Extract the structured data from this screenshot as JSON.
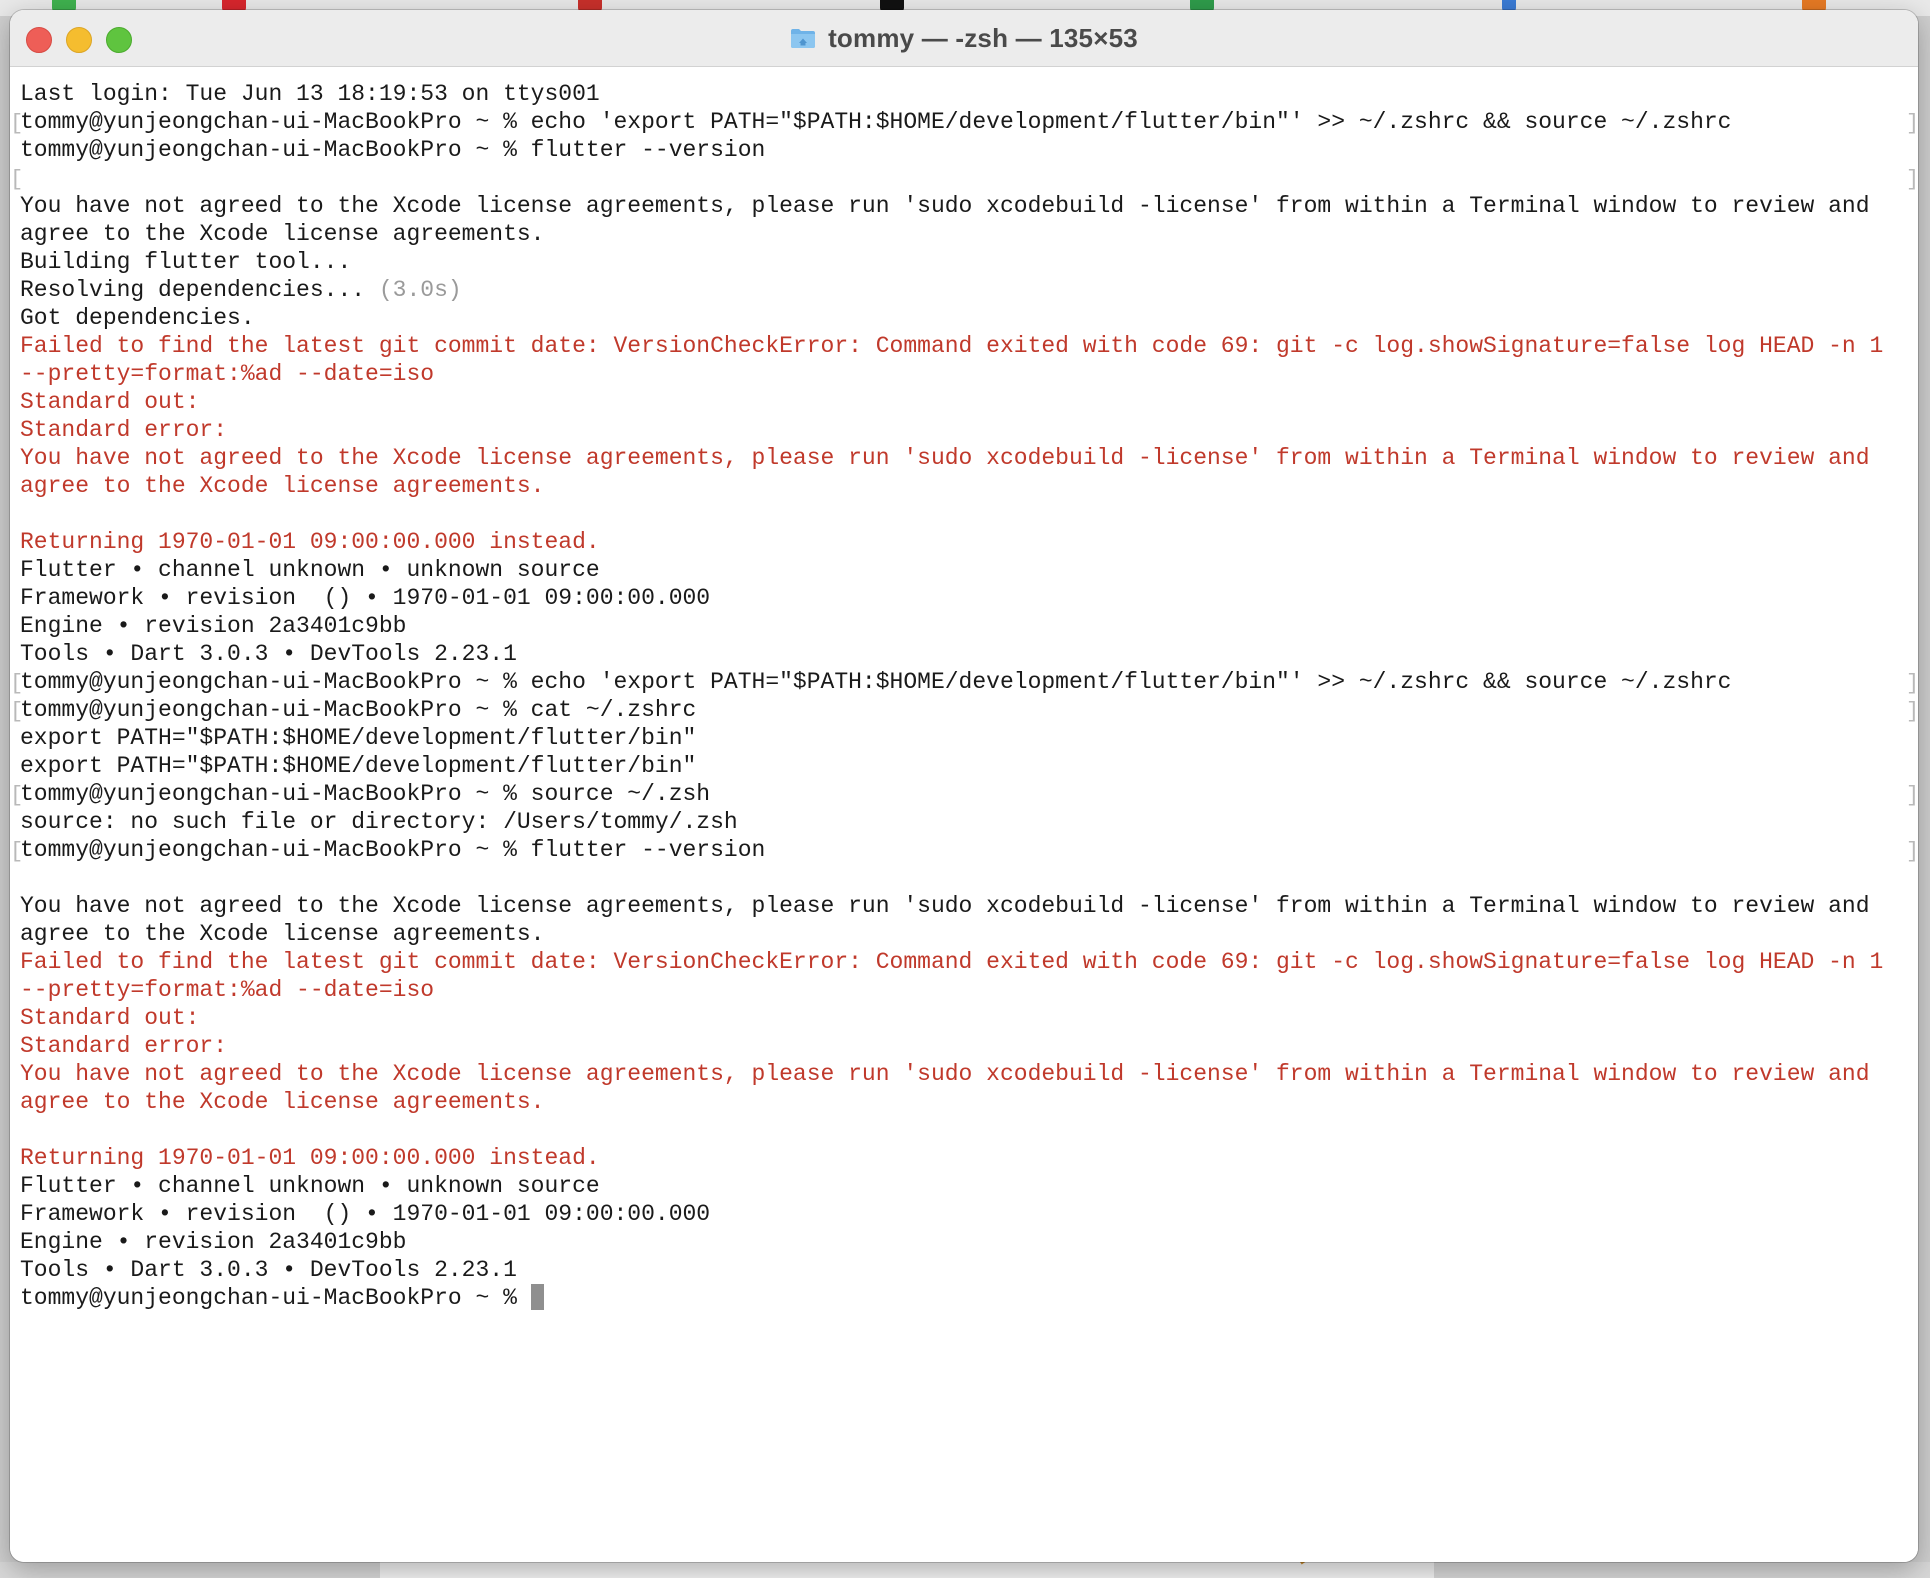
{
  "window": {
    "title": "tommy — -zsh — 135×53"
  },
  "terminal": {
    "lines": [
      {
        "text": "Last login: Tue Jun 13 18:19:53 on ttys001",
        "style": "normal",
        "marker": false
      },
      {
        "text": "tommy@yunjeongchan-ui-MacBookPro ~ % echo 'export PATH=\"$PATH:$HOME/development/flutter/bin\"' >> ~/.zshrc && source ~/.zshrc",
        "style": "normal",
        "marker": true
      },
      {
        "text": "tommy@yunjeongchan-ui-MacBookPro ~ % flutter --version",
        "style": "normal",
        "marker": false
      },
      {
        "text": "",
        "style": "normal",
        "marker": true
      },
      {
        "text": "You have not agreed to the Xcode license agreements, please run 'sudo xcodebuild -license' from within a Terminal window to review and",
        "style": "normal",
        "marker": false
      },
      {
        "text": "agree to the Xcode license agreements.",
        "style": "normal",
        "marker": false
      },
      {
        "text": "Building flutter tool...",
        "style": "normal",
        "marker": false
      },
      {
        "text": "Resolving dependencies... ",
        "suffix": "(3.0s)",
        "style": "normal",
        "marker": false
      },
      {
        "text": "Got dependencies.",
        "style": "normal",
        "marker": false
      },
      {
        "text": "Failed to find the latest git commit date: VersionCheckError: Command exited with code 69: git -c log.showSignature=false log HEAD -n 1",
        "style": "err",
        "marker": false
      },
      {
        "text": "--pretty=format:%ad --date=iso",
        "style": "err",
        "marker": false
      },
      {
        "text": "Standard out:",
        "style": "err",
        "marker": false
      },
      {
        "text": "Standard error:",
        "style": "err",
        "marker": false
      },
      {
        "text": "You have not agreed to the Xcode license agreements, please run 'sudo xcodebuild -license' from within a Terminal window to review and",
        "style": "err",
        "marker": false
      },
      {
        "text": "agree to the Xcode license agreements.",
        "style": "err",
        "marker": false
      },
      {
        "text": "",
        "style": "normal",
        "marker": false
      },
      {
        "text": "Returning 1970-01-01 09:00:00.000 instead.",
        "style": "err",
        "marker": false
      },
      {
        "text": "Flutter • channel unknown • unknown source",
        "style": "normal",
        "marker": false
      },
      {
        "text": "Framework • revision  () • 1970-01-01 09:00:00.000",
        "style": "normal",
        "marker": false
      },
      {
        "text": "Engine • revision 2a3401c9bb",
        "style": "normal",
        "marker": false
      },
      {
        "text": "Tools • Dart 3.0.3 • DevTools 2.23.1",
        "style": "normal",
        "marker": false
      },
      {
        "text": "tommy@yunjeongchan-ui-MacBookPro ~ % echo 'export PATH=\"$PATH:$HOME/development/flutter/bin\"' >> ~/.zshrc && source ~/.zshrc",
        "style": "normal",
        "marker": true
      },
      {
        "text": "tommy@yunjeongchan-ui-MacBookPro ~ % cat ~/.zshrc",
        "style": "normal",
        "marker": true
      },
      {
        "text": "export PATH=\"$PATH:$HOME/development/flutter/bin\"",
        "style": "normal",
        "marker": false
      },
      {
        "text": "export PATH=\"$PATH:$HOME/development/flutter/bin\"",
        "style": "normal",
        "marker": false
      },
      {
        "text": "tommy@yunjeongchan-ui-MacBookPro ~ % source ~/.zsh",
        "style": "normal",
        "marker": true
      },
      {
        "text": "source: no such file or directory: /Users/tommy/.zsh",
        "style": "normal",
        "marker": false
      },
      {
        "text": "tommy@yunjeongchan-ui-MacBookPro ~ % flutter --version",
        "style": "normal",
        "marker": true
      },
      {
        "text": "",
        "style": "normal",
        "marker": false
      },
      {
        "text": "You have not agreed to the Xcode license agreements, please run 'sudo xcodebuild -license' from within a Terminal window to review and",
        "style": "normal",
        "marker": false
      },
      {
        "text": "agree to the Xcode license agreements.",
        "style": "normal",
        "marker": false
      },
      {
        "text": "Failed to find the latest git commit date: VersionCheckError: Command exited with code 69: git -c log.showSignature=false log HEAD -n 1",
        "style": "err",
        "marker": false
      },
      {
        "text": "--pretty=format:%ad --date=iso",
        "style": "err",
        "marker": false
      },
      {
        "text": "Standard out:",
        "style": "err",
        "marker": false
      },
      {
        "text": "Standard error:",
        "style": "err",
        "marker": false
      },
      {
        "text": "You have not agreed to the Xcode license agreements, please run 'sudo xcodebuild -license' from within a Terminal window to review and",
        "style": "err",
        "marker": false
      },
      {
        "text": "agree to the Xcode license agreements.",
        "style": "err",
        "marker": false
      },
      {
        "text": "",
        "style": "normal",
        "marker": false
      },
      {
        "text": "Returning 1970-01-01 09:00:00.000 instead.",
        "style": "err",
        "marker": false
      },
      {
        "text": "Flutter • channel unknown • unknown source",
        "style": "normal",
        "marker": false
      },
      {
        "text": "Framework • revision  () • 1970-01-01 09:00:00.000",
        "style": "normal",
        "marker": false
      },
      {
        "text": "Engine • revision 2a3401c9bb",
        "style": "normal",
        "marker": false
      },
      {
        "text": "Tools • Dart 3.0.3 • DevTools 2.23.1",
        "style": "normal",
        "marker": false
      },
      {
        "text": "tommy@yunjeongchan-ui-MacBookPro ~ % ",
        "style": "normal",
        "marker": false,
        "cursor": true
      }
    ]
  },
  "colors": {
    "error_text": "#c0392b",
    "normal_text": "#1a1a1a",
    "dim_text": "#9a9a9a"
  },
  "icons": {
    "folder": "folder-icon",
    "close": "close-button",
    "minimize": "minimize-button",
    "zoom": "zoom-button"
  }
}
